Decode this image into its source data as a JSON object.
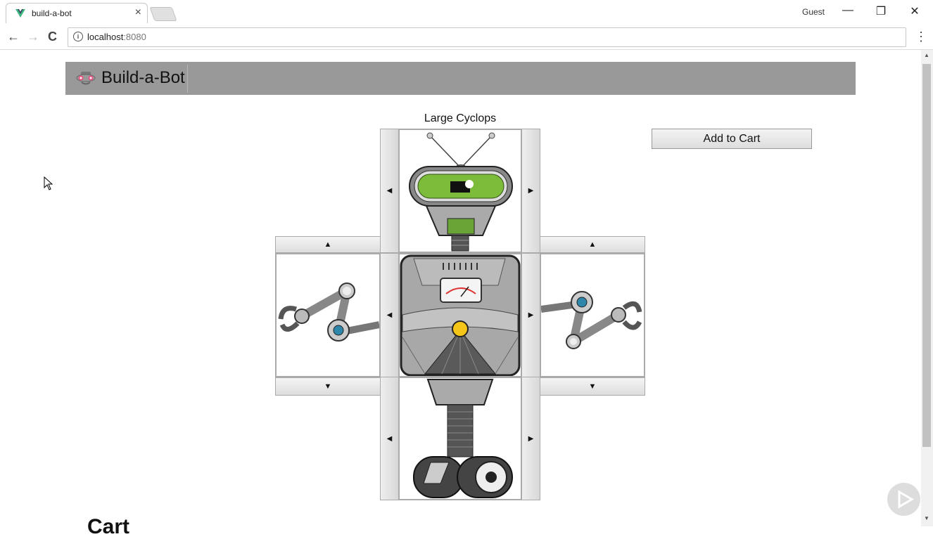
{
  "browser": {
    "tab_title": "build-a-bot",
    "tab_close": "×",
    "profile": "Guest",
    "url_host": "localhost",
    "url_port": ":8080",
    "back": "←",
    "forward": "→",
    "reload": "C",
    "minimize": "—",
    "restore": "❐",
    "close": "✕",
    "menu": "⋮"
  },
  "app": {
    "title": "Build-a-Bot"
  },
  "builder": {
    "robot_name": "Large Cyclops",
    "add_to_cart": "Add to Cart",
    "head": {
      "prev": "◀",
      "next": "▶"
    },
    "left_arm": {
      "prev": "▲",
      "next": "▼"
    },
    "torso": {
      "prev": "◀",
      "next": "▶"
    },
    "right_arm": {
      "prev": "▲",
      "next": "▼"
    },
    "base": {
      "prev": "◀",
      "next": "▶"
    }
  },
  "cart": {
    "heading": "Cart"
  },
  "colors": {
    "header_bg": "#999999",
    "eye_green": "#7dbb3a",
    "joint_blue": "#2e86ab",
    "torso_gray": "#a8a8a8",
    "light_yellow": "#f5c518"
  }
}
